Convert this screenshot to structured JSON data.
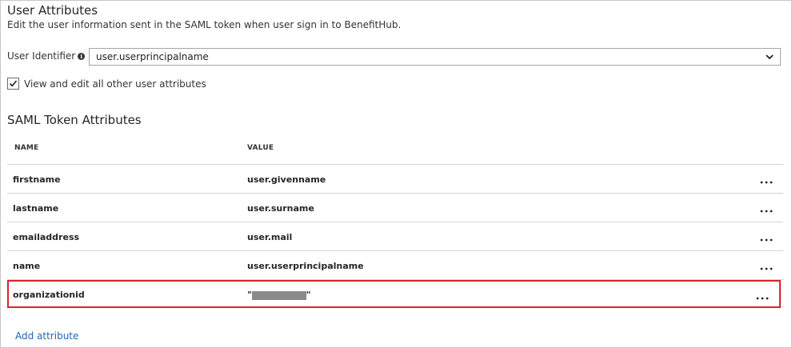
{
  "section": {
    "title": "User Attributes",
    "description": "Edit the user information sent in the SAML token when user sign in to BenefitHub."
  },
  "user_identifier": {
    "label": "User Identifier",
    "value": "user.userprincipalname"
  },
  "view_all_checkbox": {
    "label": "View and edit all other user attributes",
    "checked": true
  },
  "saml": {
    "heading": "SAML Token Attributes",
    "columns": {
      "name": "NAME",
      "value": "VALUE"
    },
    "rows": [
      {
        "name": "firstname",
        "value": "user.givenname"
      },
      {
        "name": "lastname",
        "value": "user.surname"
      },
      {
        "name": "emailaddress",
        "value": "user.mail"
      },
      {
        "name": "name",
        "value": "user.userprincipalname"
      },
      {
        "name": "organizationid",
        "value": "\""
      }
    ],
    "more_glyph": "..."
  },
  "add_attribute_label": "Add attribute",
  "colors": {
    "highlight": "#d9232e",
    "link": "#1a69b5"
  }
}
